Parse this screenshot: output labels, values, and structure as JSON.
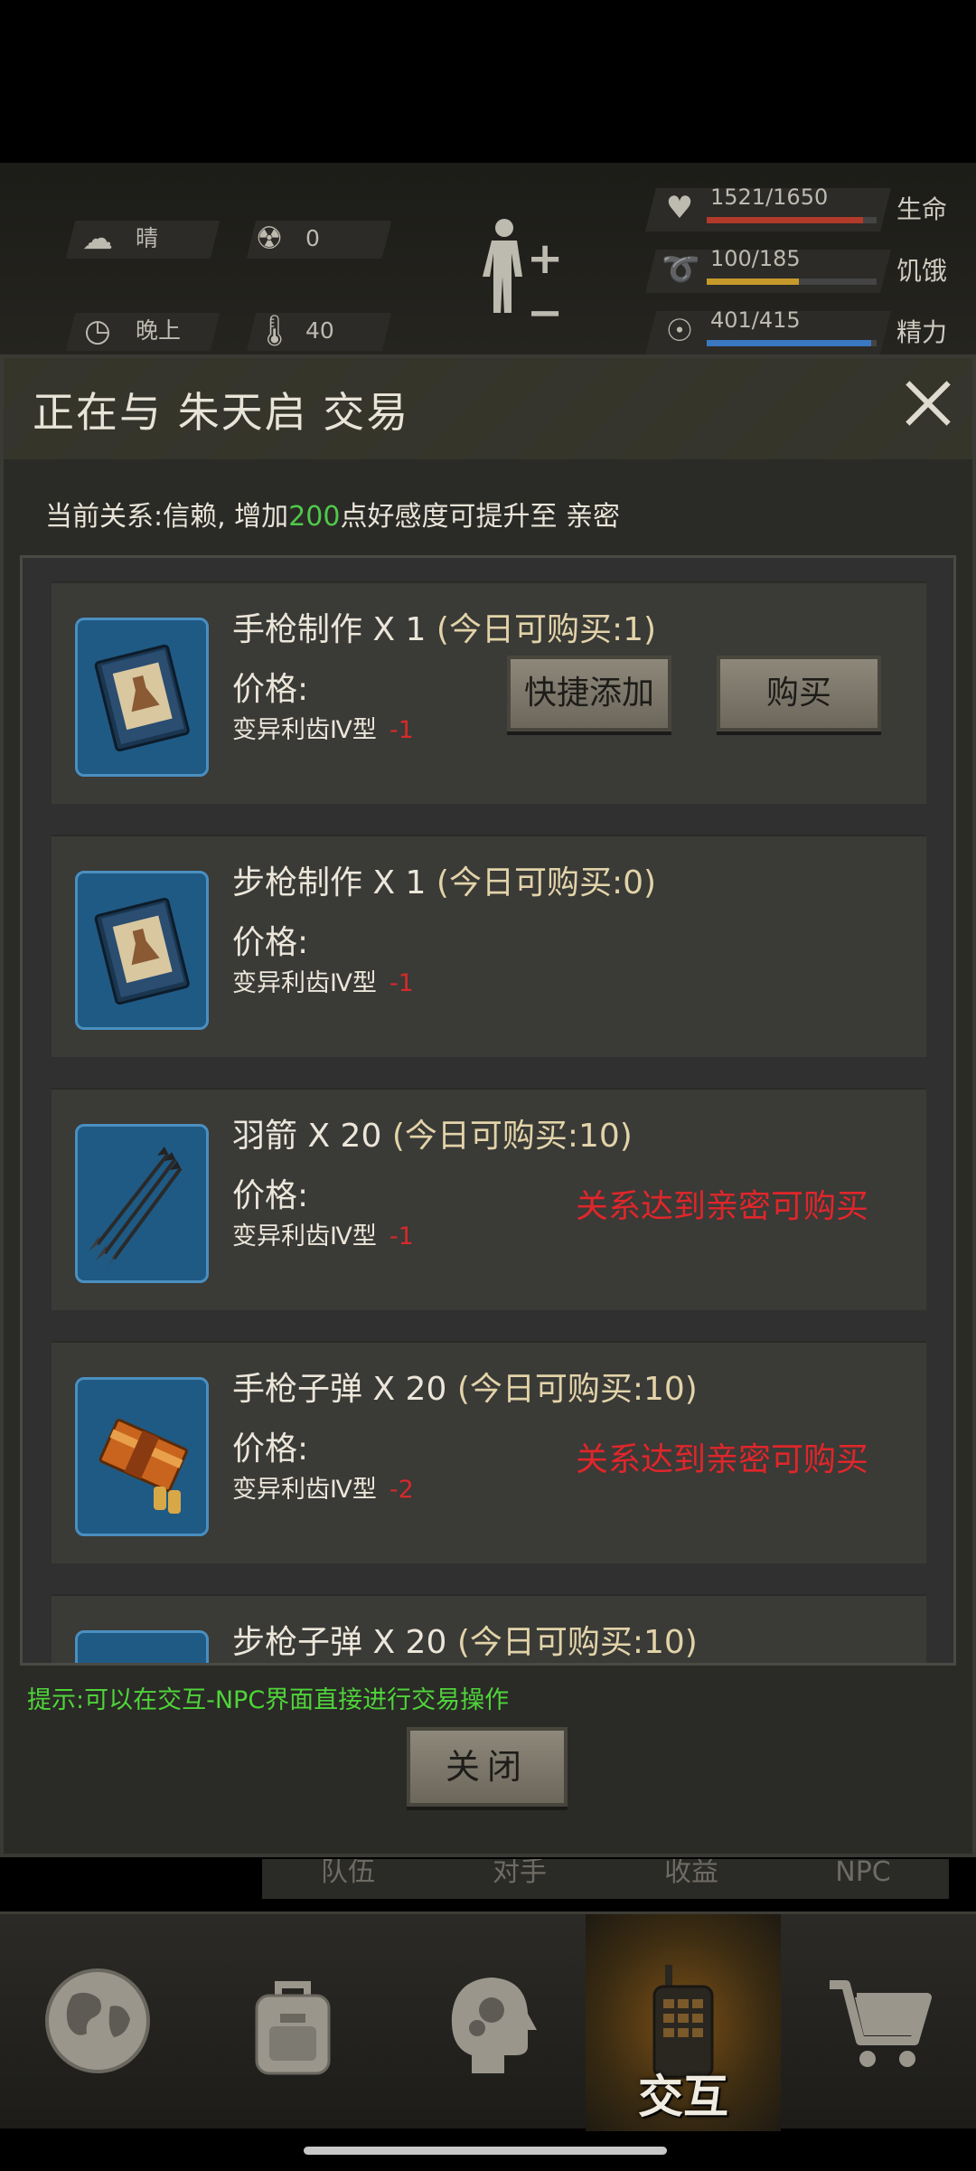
{
  "hud": {
    "weather": "晴",
    "radiation": "0",
    "time_of_day": "晚上",
    "temperature": "40",
    "vitals": [
      {
        "value": "1521/1650",
        "name": "生命",
        "fill": 0.92,
        "color": "#b23a2a"
      },
      {
        "value": "100/185",
        "name": "饥饿",
        "fill": 0.54,
        "color": "#c69a2a"
      },
      {
        "value": "401/415",
        "name": "精力",
        "fill": 0.97,
        "color": "#3a78c2"
      }
    ]
  },
  "dialog": {
    "title": "正在与 朱天启 交易",
    "relation_prefix": "当前关系:信赖, 增加",
    "relation_points": "200",
    "relation_suffix": "点好感度可提升至 亲密",
    "items": [
      {
        "name": "手枪制作 X 1",
        "limit": "(今日可购买:1)",
        "price_label": "价格:",
        "price_item": "变异利齿Ⅳ型",
        "price_cost": "-1",
        "icon": "blueprint-book-icon",
        "state": "buyable"
      },
      {
        "name": "步枪制作 X 1",
        "limit": "(今日可购买:0)",
        "price_label": "价格:",
        "price_item": "变异利齿Ⅳ型",
        "price_cost": "-1",
        "icon": "blueprint-book-icon",
        "state": "none"
      },
      {
        "name": "羽箭 X 20",
        "limit": "(今日可购买:10)",
        "price_label": "价格:",
        "price_item": "变异利齿Ⅳ型",
        "price_cost": "-1",
        "icon": "arrows-icon",
        "state": "locked"
      },
      {
        "name": "手枪子弹 X 20",
        "limit": "(今日可购买:10)",
        "price_label": "价格:",
        "price_item": "变异利齿Ⅳ型",
        "price_cost": "-2",
        "icon": "ammo-box-icon",
        "state": "locked"
      },
      {
        "name": "步枪子弹 X 20",
        "limit": "(今日可购买:10)",
        "icon": "ammo-icon",
        "state": "partial"
      }
    ],
    "quick_add_label": "快捷添加",
    "buy_label": "购买",
    "locked_text": "关系达到亲密可购买",
    "hint": "提示:可以在交互-NPC界面直接进行交易操作",
    "close_label": "关闭"
  },
  "subtabs": [
    "队伍",
    "对手",
    "收益",
    "NPC"
  ],
  "nav": {
    "items": [
      {
        "icon": "globe-icon"
      },
      {
        "icon": "backpack-icon"
      },
      {
        "icon": "head-gears-icon"
      },
      {
        "icon": "walkie-talkie-icon",
        "label": "交互",
        "active": true
      },
      {
        "icon": "shopping-cart-icon"
      }
    ]
  }
}
